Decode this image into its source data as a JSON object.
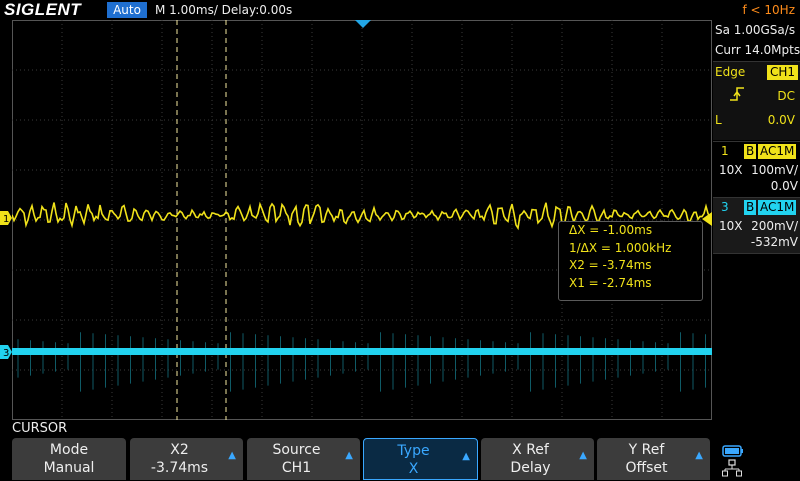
{
  "header": {
    "logo": "SIGLENT",
    "acq_mode": "Auto",
    "timebase": "M 1.00ms/ Delay:0.00s",
    "trigger_freq": "f < 10Hz"
  },
  "acquisition": {
    "sample_rate": "Sa 1.00GSa/s",
    "memory": "Curr 14.0Mpts"
  },
  "trigger": {
    "type_label": "Edge",
    "source": "CH1",
    "slope_icon": "rising-edge-icon",
    "coupling": "DC",
    "level_label": "L",
    "level": "0.0V"
  },
  "channels": [
    {
      "num": "1",
      "bw": "B",
      "coupling": "AC1M",
      "probe": "10X",
      "scale": "100mV/",
      "offset": "0.0V",
      "color": "#f0e21a"
    },
    {
      "num": "3",
      "bw": "B",
      "coupling": "AC1M",
      "probe": "10X",
      "scale": "200mV/",
      "offset": "-532mV",
      "color": "#22d3f0"
    }
  ],
  "markers": {
    "ch1": "1",
    "ch3": "3"
  },
  "cursor_readout": {
    "delta_x": "ΔX = -1.00ms",
    "inv_delta_x": "1/ΔX = 1.000kHz",
    "x2": "X2 = -3.74ms",
    "x1": "X1 = -2.74ms"
  },
  "menu": {
    "title": "CURSOR",
    "buttons": [
      {
        "line1": "Mode",
        "line2": "Manual",
        "arrow": false
      },
      {
        "line1": "X2",
        "line2": "-3.74ms",
        "arrow": true
      },
      {
        "line1": "Source",
        "line2": "CH1",
        "arrow": true
      },
      {
        "line1": "Type",
        "line2": "X",
        "arrow": true
      },
      {
        "line1": "X Ref",
        "line2": "Delay",
        "arrow": true
      },
      {
        "line1": "Y Ref",
        "line2": "Offset",
        "arrow": true
      }
    ]
  },
  "status_icons": [
    "battery-icon",
    "network-icon"
  ],
  "colors": {
    "ch1": "#f0e21a",
    "ch3": "#22d3f0",
    "accent": "#3aa8ff",
    "trigger_freq": "#ff8c1a"
  }
}
